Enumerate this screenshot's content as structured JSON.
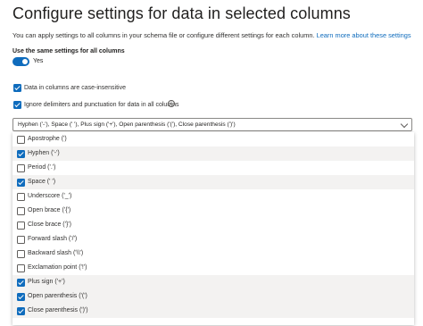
{
  "page": {
    "title": "Configure settings for data in selected columns",
    "description": "You can apply settings to all columns in your schema file or configure different settings for each column.",
    "learn_more": "Learn more about these settings"
  },
  "same_settings": {
    "label": "Use the same settings for all columns",
    "state": "Yes",
    "on": true
  },
  "case_insensitive": {
    "label": "Data in columns are case-insensitive",
    "checked": true
  },
  "ignore_delimiters": {
    "label": "Ignore delimiters and punctuation for data in all columns",
    "checked": true
  },
  "delimiter_select": {
    "value": "Hyphen ('-'), Space (' '), Plus sign ('+'), Open parenthesis ('('), Close parenthesis (')')",
    "options": [
      {
        "label": "Apostrophe (')",
        "checked": false
      },
      {
        "label": "Hyphen ('-')",
        "checked": true
      },
      {
        "label": "Period ('.')",
        "checked": false
      },
      {
        "label": "Space (' ')",
        "checked": true
      },
      {
        "label": "Underscore ('_')",
        "checked": false
      },
      {
        "label": "Open brace ('{')",
        "checked": false
      },
      {
        "label": "Close brace ('}')",
        "checked": false
      },
      {
        "label": "Forward slash ('/')",
        "checked": false
      },
      {
        "label": "Backward slash ('\\\\')",
        "checked": false
      },
      {
        "label": "Exclamation point ('!')",
        "checked": false
      },
      {
        "label": "Plus sign ('+')",
        "checked": true
      },
      {
        "label": "Open parenthesis ('(')",
        "checked": true
      },
      {
        "label": "Close parenthesis (')')",
        "checked": true
      }
    ]
  },
  "colors": {
    "accent": "#0f6cbd",
    "selected_row": "#f3f2f1"
  }
}
